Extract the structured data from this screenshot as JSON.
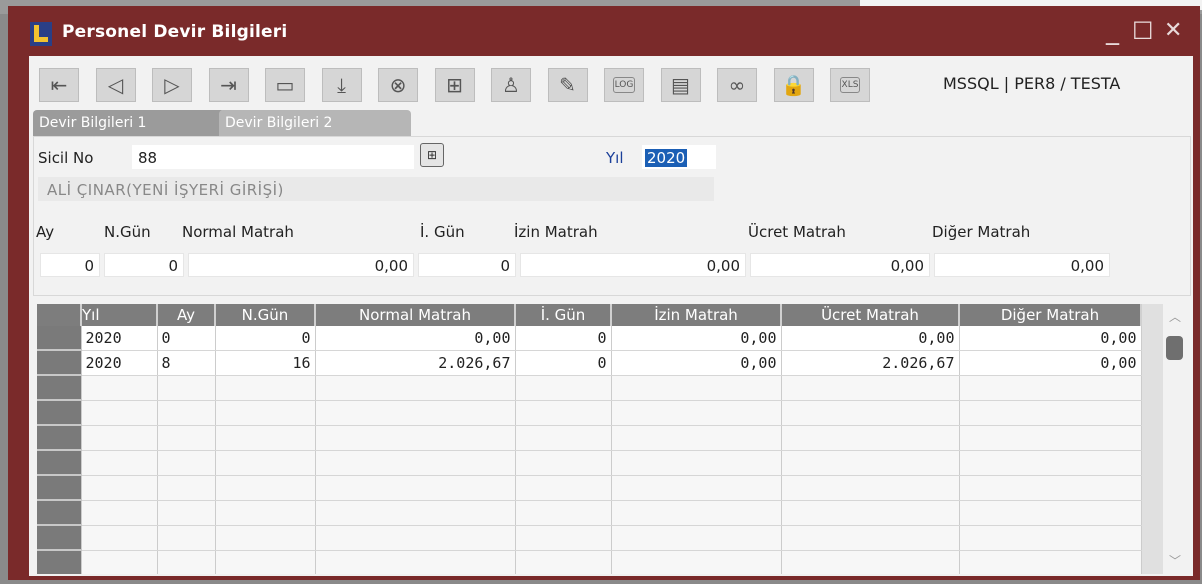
{
  "window": {
    "title": "Personel Devir Bilgileri",
    "controls": {
      "minimize": "_",
      "maximize": "☐",
      "close": "✕"
    }
  },
  "toolbar": {
    "buttons": [
      {
        "name": "first-record-icon",
        "glyph": "⇤"
      },
      {
        "name": "previous-record-icon",
        "glyph": "◁"
      },
      {
        "name": "next-record-icon",
        "glyph": "▷"
      },
      {
        "name": "last-record-icon",
        "glyph": "⇥"
      },
      {
        "name": "new-record-icon",
        "glyph": "▭"
      },
      {
        "name": "save-icon",
        "glyph": "⤓"
      },
      {
        "name": "delete-icon",
        "glyph": "⊗"
      },
      {
        "name": "copy-icon",
        "glyph": "⊞"
      },
      {
        "name": "user-icon",
        "glyph": "♙"
      },
      {
        "name": "edit-pencil-icon",
        "glyph": "✎"
      },
      {
        "name": "log-icon",
        "glyph": "LOG"
      },
      {
        "name": "document-icon",
        "glyph": "▤"
      },
      {
        "name": "link-icon",
        "glyph": "∞"
      },
      {
        "name": "lock-icon",
        "glyph": "🔒"
      },
      {
        "name": "excel-export-icon",
        "glyph": "XLS"
      }
    ],
    "connection": "MSSQL | PER8 / TESTA"
  },
  "tabs": [
    {
      "label": "Devir Bilgileri 1",
      "active": true
    },
    {
      "label": "Devir Bilgileri 2",
      "active": false
    }
  ],
  "form": {
    "sicil_label": "Sicil No",
    "sicil_value": "88",
    "yil_label": "Yıl",
    "yil_value": "2020",
    "name_value": "ALİ ÇINAR(YENİ İŞYERİ GİRİŞİ)",
    "labels": {
      "ay": "Ay",
      "ngun": "N.Gün",
      "normal": "Normal Matrah",
      "igun": "İ. Gün",
      "izin": "İzin Matrah",
      "ucret": "Ücret Matrah",
      "diger": "Diğer Matrah"
    },
    "values": {
      "ay": "0",
      "ngun": "0",
      "normal": "0,00",
      "igun": "0",
      "izin": "0,00",
      "ucret": "0,00",
      "diger": "0,00"
    }
  },
  "grid": {
    "columns": [
      "Yıl",
      "Ay",
      "N.Gün",
      "Normal Matrah",
      "İ. Gün",
      "İzin Matrah",
      "Ücret Matrah",
      "Diğer Matrah"
    ],
    "rows": [
      [
        "2020",
        "0",
        "0",
        "0,00",
        "0",
        "0,00",
        "0,00",
        "0,00"
      ],
      [
        "2020",
        "8",
        "16",
        "2.026,67",
        "0",
        "0,00",
        "2.026,67",
        "0,00"
      ]
    ],
    "empty_rows": 8
  },
  "colors": {
    "title_bar": "#7a2a2a",
    "grid_header": "#7d7d7d",
    "selection": "#1b5fb5"
  }
}
